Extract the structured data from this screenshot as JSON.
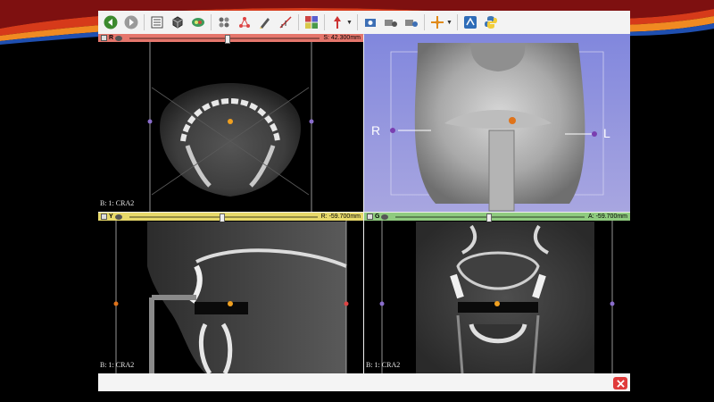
{
  "toolbar": {
    "buttons": [
      {
        "name": "back-button",
        "icon": "back-arrow-icon"
      },
      {
        "name": "forward-button",
        "icon": "forward-arrow-icon"
      },
      {
        "name": "data-button",
        "icon": "data-icon"
      },
      {
        "name": "volume-button",
        "icon": "volume-cube-icon"
      },
      {
        "name": "models-button",
        "icon": "models-icon"
      },
      {
        "name": "transforms-button",
        "icon": "transforms-icon"
      },
      {
        "name": "markups-button",
        "icon": "markups-icon"
      },
      {
        "name": "editor-button",
        "icon": "editor-icon"
      },
      {
        "name": "measure-button",
        "icon": "measure-icon"
      },
      {
        "name": "layout-button",
        "icon": "layout-grid-icon"
      },
      {
        "name": "mouse-mode-button",
        "icon": "arrow-mode-icon"
      },
      {
        "name": "screenshot-button",
        "icon": "screenshot-icon"
      },
      {
        "name": "scene-view-button",
        "icon": "scene-view-icon"
      },
      {
        "name": "scene-view-2-button",
        "icon": "scene-view-2-icon"
      },
      {
        "name": "crosshair-button",
        "icon": "crosshair-icon"
      },
      {
        "name": "extension-button",
        "icon": "extension-icon"
      },
      {
        "name": "python-button",
        "icon": "python-icon"
      }
    ]
  },
  "colors": {
    "red": "#e5766c",
    "yellow": "#e7d96a",
    "green": "#8fcb7f",
    "blue3d": "#8a8de0",
    "close": "#e03b3b"
  },
  "views": {
    "red": {
      "id": "R",
      "offset": "S: 42.300mm",
      "volume_label": "B: 1: CRA2"
    },
    "view3d": {
      "id": "1",
      "left_label": "R",
      "right_label": "L"
    },
    "yellow": {
      "id": "Y",
      "offset": "R: -59.700mm",
      "volume_label": "B: 1: CRA2"
    },
    "green": {
      "id": "G",
      "offset": "A: -59.700mm",
      "volume_label": "B: 1: CRA2"
    }
  }
}
